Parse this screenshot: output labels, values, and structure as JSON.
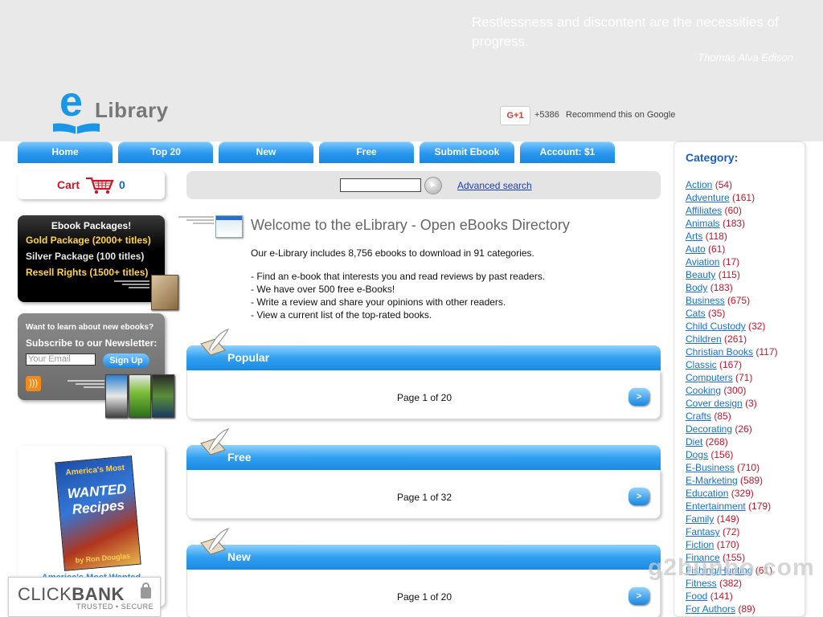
{
  "header": {
    "quote": "Restlessness and discontent are the necessities of progress.",
    "quote_author": "Thomas Alva Edison",
    "logo_letter": "e",
    "logo_text": "Library",
    "gplus_label": "G+1",
    "gplus_count": "+5386",
    "gplus_text": "Recommend this on Google"
  },
  "nav": {
    "tabs": [
      "Home",
      "Top 20",
      "New",
      "Free",
      "Submit Ebook",
      "Account: $1"
    ]
  },
  "cart": {
    "label": "Cart",
    "count": "0"
  },
  "packages": {
    "title": "Ebook Packages!",
    "items": [
      {
        "label": "Gold Package (2000+ titles)",
        "color": "#ffd34a"
      },
      {
        "label": "Silver Package (100 titles)",
        "color": "#e8e8e8"
      },
      {
        "label": "Resell Rights (1500+ titles)",
        "color": "#ffd34a"
      }
    ]
  },
  "newsletter": {
    "question": "Want to learn about new ebooks?",
    "subscribe": "Subscribe to our Newsletter:",
    "email_placeholder": "Your Email",
    "signup": "Sign Up",
    "rss_icon": "rss-icon"
  },
  "promo": {
    "cover_sub": "America's Most",
    "cover_title": "WANTED Recipes",
    "cover_brand": "by Ron Douglas",
    "link": "America's Most Wanted"
  },
  "clickbank": {
    "brand_light": "CLICK",
    "brand_bold": "BANK",
    "sub": "TRUSTED • SECURE"
  },
  "search": {
    "go": "►",
    "advanced": "Advanced search"
  },
  "welcome": {
    "title": "Welcome to the eLibrary - Open eBooks Directory",
    "intro": "Our e-Library includes 8,756 ebooks to download in 91 categories.",
    "bullets": [
      "- Find an e-book that interests you and read reviews by past readers.",
      "- We have over 500 free e-Books!",
      "- Write a review and share your opinions with other readers.",
      "- View a current list of the top-rated books."
    ]
  },
  "sections": [
    {
      "title": "Popular",
      "page": "Page 1 of 20",
      "next": ">"
    },
    {
      "title": "Free",
      "page": "Page 1 of 32",
      "next": ">"
    },
    {
      "title": "New",
      "page": "Page 1 of 20",
      "next": ">"
    }
  ],
  "categories": {
    "title": "Category:",
    "items": [
      {
        "name": "Action",
        "count": "(54)"
      },
      {
        "name": "Adventure",
        "count": "(161)"
      },
      {
        "name": "Affiliates",
        "count": "(60)"
      },
      {
        "name": "Animals",
        "count": "(183)"
      },
      {
        "name": "Arts",
        "count": "(118)"
      },
      {
        "name": "Auto",
        "count": "(61)"
      },
      {
        "name": "Aviation",
        "count": "(17)"
      },
      {
        "name": "Beauty",
        "count": "(115)"
      },
      {
        "name": "Body",
        "count": "(183)"
      },
      {
        "name": "Business",
        "count": "(675)"
      },
      {
        "name": "Cats",
        "count": "(35)"
      },
      {
        "name": "Child Custody",
        "count": "(32)"
      },
      {
        "name": "Children",
        "count": "(261)"
      },
      {
        "name": "Christian Books",
        "count": "(117)"
      },
      {
        "name": "Classic",
        "count": "(167)"
      },
      {
        "name": "Computers",
        "count": "(71)"
      },
      {
        "name": "Cooking",
        "count": "(300)"
      },
      {
        "name": "Cover design",
        "count": "(3)"
      },
      {
        "name": "Crafts",
        "count": "(85)"
      },
      {
        "name": "Decorating",
        "count": "(26)"
      },
      {
        "name": "Diet",
        "count": "(268)"
      },
      {
        "name": "Dogs",
        "count": "(156)"
      },
      {
        "name": "E-Business",
        "count": "(710)"
      },
      {
        "name": "E-Marketing",
        "count": "(589)"
      },
      {
        "name": "Education",
        "count": "(329)"
      },
      {
        "name": "Entertainment",
        "count": "(179)"
      },
      {
        "name": "Family",
        "count": "(149)"
      },
      {
        "name": "Fantasy",
        "count": "(72)"
      },
      {
        "name": "Fiction",
        "count": "(170)"
      },
      {
        "name": "Finance",
        "count": "(155)"
      },
      {
        "name": "Fishing/Hunting",
        "count": "(61)"
      },
      {
        "name": "Fitness",
        "count": "(382)"
      },
      {
        "name": "Food",
        "count": "(141)"
      },
      {
        "name": "For Authors",
        "count": "(89)"
      }
    ]
  },
  "watermark": "g2bunbo.com"
}
